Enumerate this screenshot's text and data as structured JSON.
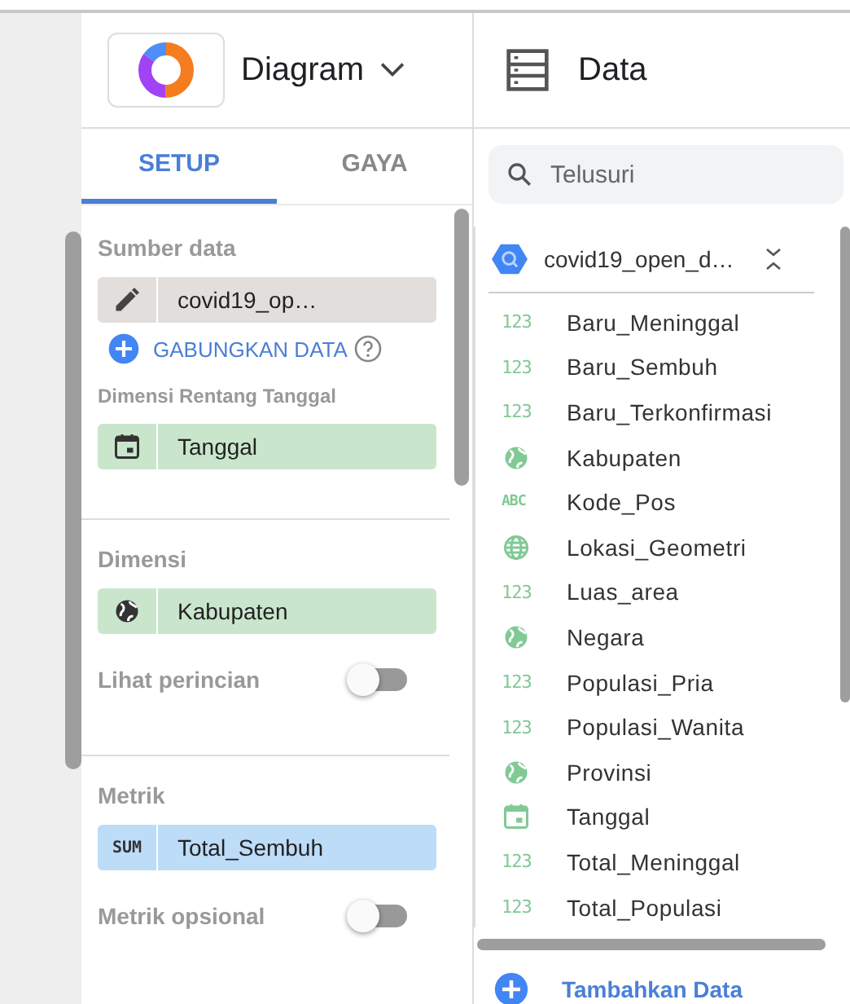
{
  "chart_panel": {
    "title": "Diagram"
  },
  "tabs": [
    {
      "label": "SETUP",
      "selected": true
    },
    {
      "label": "GAYA",
      "selected": false
    }
  ],
  "data_source": {
    "heading": "Sumber data",
    "name": "covid19_op…",
    "blend_label": "GABUNGKAN DATA"
  },
  "date_range": {
    "heading": "Dimensi Rentang Tanggal",
    "chip": {
      "kind": "date",
      "name": "Tanggal"
    }
  },
  "dimension": {
    "heading": "Dimensi",
    "chip": {
      "kind": "geo",
      "name": "Kabupaten"
    },
    "toggle": {
      "label": "Lihat perincian",
      "on": false
    }
  },
  "metric": {
    "heading": "Metrik",
    "chip": {
      "kind": "metric",
      "aggregation": "SUM",
      "name": "Total_Sembuh"
    },
    "toggle": {
      "label": "Metrik opsional",
      "on": false
    }
  },
  "data_panel": {
    "title": "Data",
    "search": {
      "placeholder": "Telusuri"
    },
    "dataset": "covid19_open_d…",
    "fields": [
      {
        "kind": "number",
        "type_label": "123",
        "name": "Baru_Meninggal"
      },
      {
        "kind": "number",
        "type_label": "123",
        "name": "Baru_Sembuh"
      },
      {
        "kind": "number",
        "type_label": "123",
        "name": "Baru_Terkonfirmasi"
      },
      {
        "kind": "geo",
        "name": "Kabupaten"
      },
      {
        "kind": "text",
        "type_label": "ABC",
        "name": "Kode_Pos"
      },
      {
        "kind": "geopoint",
        "name": "Lokasi_Geometri"
      },
      {
        "kind": "number",
        "type_label": "123",
        "name": "Luas_area"
      },
      {
        "kind": "geo",
        "name": "Negara"
      },
      {
        "kind": "number",
        "type_label": "123",
        "name": "Populasi_Pria"
      },
      {
        "kind": "number",
        "type_label": "123",
        "name": "Populasi_Wanita"
      },
      {
        "kind": "geo",
        "name": "Provinsi"
      },
      {
        "kind": "date",
        "name": "Tanggal"
      },
      {
        "kind": "number",
        "type_label": "123",
        "name": "Total_Meninggal"
      },
      {
        "kind": "number",
        "type_label": "123",
        "name": "Total_Populasi"
      }
    ],
    "add_label": "Tambahkan Data"
  }
}
